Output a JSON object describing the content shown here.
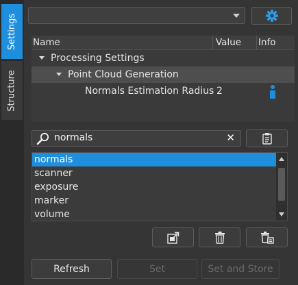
{
  "sidebar": {
    "tabs": [
      {
        "label": "Settings",
        "active": true
      },
      {
        "label": "Structure",
        "active": false
      }
    ]
  },
  "toolbar": {
    "combo_value": "",
    "settings_icon": "gear-icon"
  },
  "tree": {
    "columns": [
      "Name",
      "Value",
      "Info"
    ],
    "rows": [
      {
        "label": "Processing Settings",
        "value": ""
      },
      {
        "label": "Point Cloud Generation",
        "value": ""
      },
      {
        "label": "Normals Estimation Radius",
        "value": "2",
        "info_icon": "info-icon"
      }
    ]
  },
  "search": {
    "value": "normals",
    "search_icon": "magnifier-icon",
    "clear_icon": "close-icon"
  },
  "list": {
    "items": [
      "normals",
      "scanner",
      "exposure",
      "marker",
      "volume"
    ],
    "selected_index": 0
  },
  "actions": {
    "icons": [
      "export-icon",
      "trash-icon",
      "trash-all-icon"
    ]
  },
  "footer": {
    "refresh_label": "Refresh",
    "set_label": "Set",
    "set_store_label": "Set and Store"
  },
  "colors": {
    "accent": "#1f8fdd",
    "background": "#353535"
  }
}
